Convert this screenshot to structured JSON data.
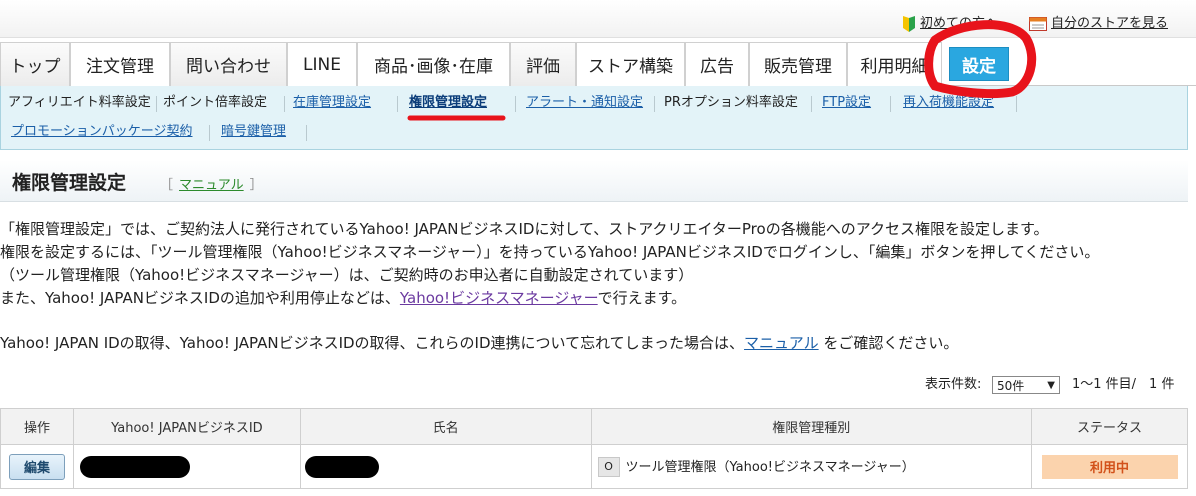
{
  "util_links": {
    "beginner": "初めての方へ",
    "store": "自分のストアを見る"
  },
  "tabs": [
    {
      "label": "トップ"
    },
    {
      "label": "注文管理"
    },
    {
      "label": "問い合わせ"
    },
    {
      "label": "LINE"
    },
    {
      "label": "商品･画像･在庫"
    },
    {
      "label": "評価"
    },
    {
      "label": "ストア構築"
    },
    {
      "label": "広告"
    },
    {
      "label": "販売管理"
    },
    {
      "label": "利用明細"
    },
    {
      "label": "設定"
    }
  ],
  "subnav": [
    {
      "label": "アフィリエイト料率設定"
    },
    {
      "label": "ポイント倍率設定"
    },
    {
      "label": "在庫管理設定"
    },
    {
      "label": "権限管理設定"
    },
    {
      "label": "アラート・通知設定"
    },
    {
      "label": "PRオプション料率設定"
    },
    {
      "label": "FTP設定"
    },
    {
      "label": "再入荷機能設定"
    },
    {
      "label": "プロモーションパッケージ契約"
    },
    {
      "label": "暗号鍵管理"
    }
  ],
  "page": {
    "title": "権限管理設定",
    "manual_open": "［",
    "manual_label": "マニュアル",
    "manual_close": "］"
  },
  "description": {
    "line1": "「権限管理設定」では、ご契約法人に発行されているYahoo! JAPANビジネスIDに対して、ストアクリエイターProの各機能へのアクセス権限を設定します。",
    "line2": "権限を設定するには、「ツール管理権限（Yahoo!ビジネスマネージャー）」を持っているYahoo! JAPANビジネスIDでログインし、「編集」ボタンを押してください。",
    "line3": "（ツール管理権限（Yahoo!ビジネスマネージャー）は、ご契約時のお申込者に自動設定されています）",
    "line4_prefix": "また、Yahoo! JAPANビジネスIDの追加や利用停止などは、",
    "line4_link": "Yahoo!ビジネスマネージャー",
    "line4_suffix": "で行えます。",
    "line5_prefix": "Yahoo! JAPAN IDの取得、Yahoo! JAPANビジネスIDの取得、これらのID連携について忘れてしまった場合は、",
    "line5_link": "マニュアル",
    "line5_suffix": "をご確認ください。"
  },
  "pagination": {
    "label": "表示件数:",
    "selected": "50件",
    "range": "1～1 件目/　1 件"
  },
  "table": {
    "headers": [
      "操作",
      "Yahoo! JAPANビジネスID",
      "氏名",
      "権限管理種別",
      "ステータス"
    ],
    "rows": [
      {
        "action": "編集",
        "perm_badge": "O",
        "perm_label": "ツール管理権限（Yahoo!ビジネスマネージャー）",
        "status": "利用中"
      }
    ]
  },
  "colors": {
    "settings_tab": "#2aa7e0",
    "subnav_bg": "#e3f3f8",
    "link": "#1b5fa8",
    "status_bg": "#fbd3ad",
    "status_text": "#d2511a",
    "annotation": "#e8131b"
  }
}
